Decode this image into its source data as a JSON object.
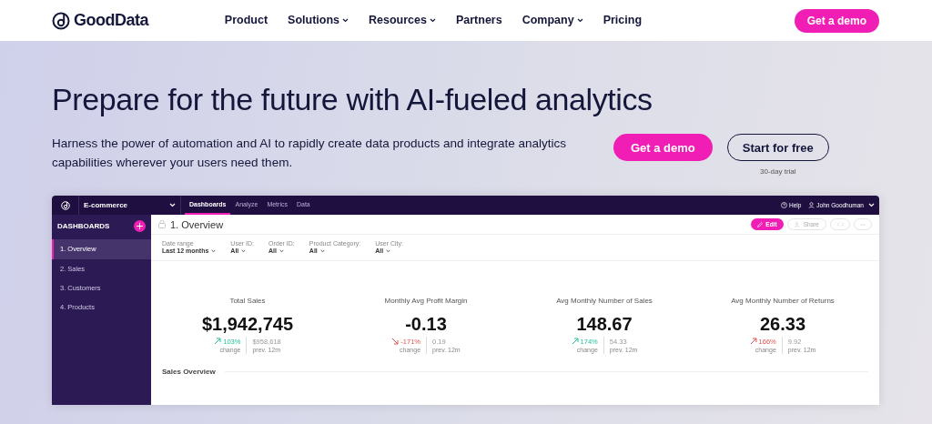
{
  "brand": "GoodData",
  "nav": [
    {
      "label": "Product",
      "dropdown": false
    },
    {
      "label": "Solutions",
      "dropdown": true
    },
    {
      "label": "Resources",
      "dropdown": true
    },
    {
      "label": "Partners",
      "dropdown": false
    },
    {
      "label": "Company",
      "dropdown": true
    },
    {
      "label": "Pricing",
      "dropdown": false
    }
  ],
  "nav_cta": "Get a demo",
  "hero": {
    "title": "Prepare for the future with AI-fueled analytics",
    "subtitle": "Harness the power of automation and AI to rapidly create data products and integrate analytics capabilities wherever your users need them.",
    "primary_button": "Get a demo",
    "secondary_button": "Start for free",
    "secondary_note": "30-day trial"
  },
  "app": {
    "workspace": "E-commerce",
    "tabs": [
      {
        "label": "Dashboards",
        "selected": true
      },
      {
        "label": "Analyze",
        "selected": false
      },
      {
        "label": "Metrics",
        "selected": false
      },
      {
        "label": "Data",
        "selected": false
      }
    ],
    "help": "Help",
    "user": "John Goodhuman",
    "sidebar": {
      "title": "DASHBOARDS",
      "items": [
        {
          "label": "1. Overview",
          "selected": true
        },
        {
          "label": "2. Sales",
          "selected": false
        },
        {
          "label": "3. Customers",
          "selected": false
        },
        {
          "label": "4. Products",
          "selected": false
        }
      ]
    },
    "dashboard_title": "1. Overview",
    "edit": "Edit",
    "share": "Share",
    "filters": [
      {
        "label": "Date range",
        "value": "Last 12 months"
      },
      {
        "label": "User ID:",
        "value": "All"
      },
      {
        "label": "Order ID:",
        "value": "All"
      },
      {
        "label": "Product Category:",
        "value": "All"
      },
      {
        "label": "User City:",
        "value": "All"
      }
    ],
    "kpis": [
      {
        "title": "Total Sales",
        "value": "$1,942,745",
        "change": "103%",
        "rising": true,
        "good": true,
        "change_label": "change",
        "previous": "$958,618",
        "previous_label": "prev. 12m"
      },
      {
        "title": "Monthly Avg Profit Margin",
        "value": "-0.13",
        "change": "-171%",
        "rising": false,
        "good": false,
        "change_label": "change",
        "previous": "0.19",
        "previous_label": "prev. 12m"
      },
      {
        "title": "Avg Monthly Number of Sales",
        "value": "148.67",
        "change": "174%",
        "rising": true,
        "good": true,
        "change_label": "change",
        "previous": "54.33",
        "previous_label": "prev. 12m"
      },
      {
        "title": "Avg Monthly Number of Returns",
        "value": "26.33",
        "change": "166%",
        "rising": true,
        "good": false,
        "change_label": "change",
        "previous": "9.92",
        "previous_label": "prev. 12m"
      }
    ],
    "section": "Sales Overview"
  }
}
